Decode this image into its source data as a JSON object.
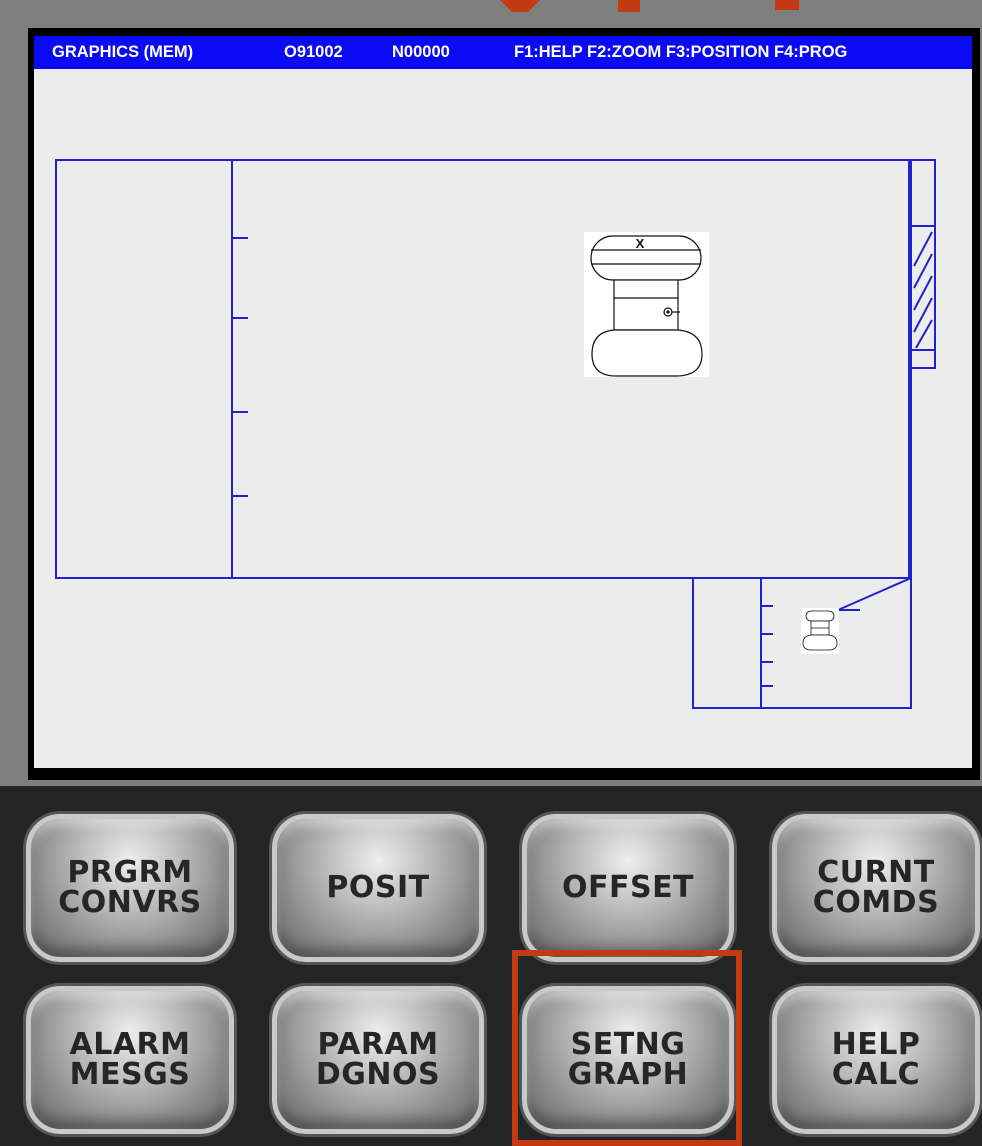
{
  "status_bar": {
    "mode": "GRAPHICS  (MEM)",
    "program": "O91002",
    "sequence": "N00000",
    "function_keys": "F1:HELP F2:ZOOM F3:POSITION F4:PROG"
  },
  "graphics": {
    "tool_marker_label": "X"
  },
  "keypad": {
    "keys": [
      {
        "label": "PRGRM\nCONVRS"
      },
      {
        "label": "POSIT"
      },
      {
        "label": "OFFSET"
      },
      {
        "label": "CURNT\nCOMDS"
      },
      {
        "label": "ALARM\nMESGS"
      },
      {
        "label": "PARAM\nDGNOS"
      },
      {
        "label": "SETNG\nGRAPH"
      },
      {
        "label": "HELP\nCALC"
      }
    ],
    "highlighted_key": "SETNG GRAPH"
  },
  "colors": {
    "status_bar": "#0a0af5",
    "graphics_lines": "#2222cc",
    "screen_background": "#ececec",
    "highlight_box": "#c23a14"
  }
}
